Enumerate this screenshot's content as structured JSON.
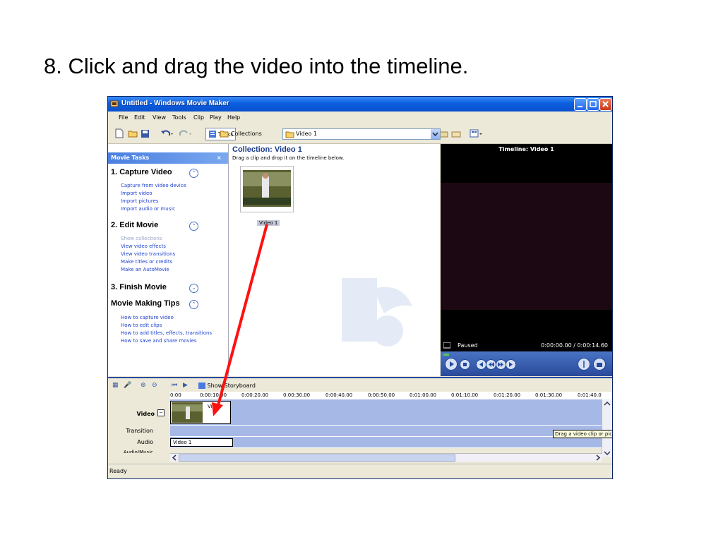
{
  "slide": {
    "title": "8.  Click and drag the video into the timeline."
  },
  "window": {
    "title": "Untitled - Windows Movie Maker"
  },
  "menu": [
    "File",
    "Edit",
    "View",
    "Tools",
    "Clip",
    "Play",
    "Help"
  ],
  "toolbar": {
    "tasks_label": "Tasks",
    "collections_label": "Collections",
    "collection_value": "Video 1"
  },
  "taskpane": {
    "header": "Movie Tasks",
    "close": "×",
    "sections": [
      {
        "title": "1. Capture Video",
        "links": [
          "Capture from video device",
          "Import video",
          "Import pictures",
          "Import audio or music"
        ]
      },
      {
        "title": "2. Edit Movie",
        "links": [
          "Show collections",
          "View video effects",
          "View video transitions",
          "Make titles or credits",
          "Make an AutoMovie"
        ]
      },
      {
        "title": "3. Finish Movie",
        "links": []
      },
      {
        "title": "Movie Making Tips",
        "links": [
          "How to capture video",
          "How to edit clips",
          "How to add titles, effects, transitions",
          "How to save and share movies"
        ]
      }
    ]
  },
  "collection": {
    "title": "Collection: Video 1",
    "subtitle": "Drag a clip and drop it on the timeline below.",
    "clip_label": "Video 1"
  },
  "preview": {
    "title": "Timeline: Video 1",
    "status": "Paused",
    "time": "0:00:00.00 / 0:00:14.60"
  },
  "timeline": {
    "storyboard_label": "Show Storyboard",
    "ruler": [
      "0:00",
      "0:00:10.00",
      "0:00:20.00",
      "0:00:30.00",
      "0:00:40.00",
      "0:00:50.00",
      "0:01:00.00",
      "0:01:10.00",
      "0:01:20.00",
      "0:01:30.00",
      "0:01:40.0"
    ],
    "tracks": {
      "video": "Video",
      "transition": "Transition",
      "audio": "Audio",
      "audio_music": "Audio/Music"
    },
    "video_clip_label": "Vid",
    "audio_clip_label": "Video 1",
    "tooltip": "Drag a video clip or pict"
  },
  "statusbar": {
    "text": "Ready"
  }
}
